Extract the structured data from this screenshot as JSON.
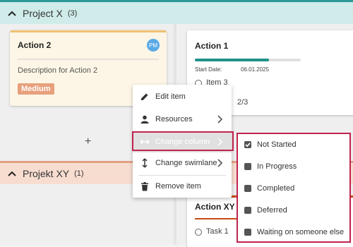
{
  "lanes": {
    "project_x": {
      "title": "Project X",
      "count": "(3)"
    },
    "projekt_xy": {
      "title": "Projekt XY",
      "count": "(1)"
    }
  },
  "cards": {
    "action2": {
      "title": "Action 2",
      "avatar": "PM",
      "description": "Description for Action 2",
      "priority": "Medium"
    },
    "action1": {
      "title": "Action 1",
      "start_label": "Start Date:",
      "start_value": "06.01.2025",
      "item": "Item 3",
      "counter": "2/3",
      "progress_fraction": 0.7
    },
    "actionxy": {
      "title": "Action XY",
      "item": "Task 1"
    }
  },
  "add_label": "+",
  "context_menu": {
    "items": [
      {
        "label": "Edit item",
        "icon": "pencil-icon"
      },
      {
        "label": "Resources",
        "icon": "person-icon"
      },
      {
        "label": "Change column",
        "icon": "arrows-horizontal-icon"
      },
      {
        "label": "Change swimlane",
        "icon": "arrows-vertical-icon"
      },
      {
        "label": "Remove item",
        "icon": "trash-icon"
      }
    ]
  },
  "submenu": {
    "items": [
      {
        "label": "Not Started",
        "checked": true
      },
      {
        "label": "In Progress",
        "checked": false
      },
      {
        "label": "Completed",
        "checked": false
      },
      {
        "label": "Deferred",
        "checked": false
      },
      {
        "label": "Waiting on someone else",
        "checked": false
      }
    ]
  },
  "colors": {
    "lane_x": "#cfeceb",
    "lane_xy": "#f7ddd0",
    "highlight": "#c0234e",
    "progress": "#1f9189",
    "avatar": "#5aa9e6"
  }
}
